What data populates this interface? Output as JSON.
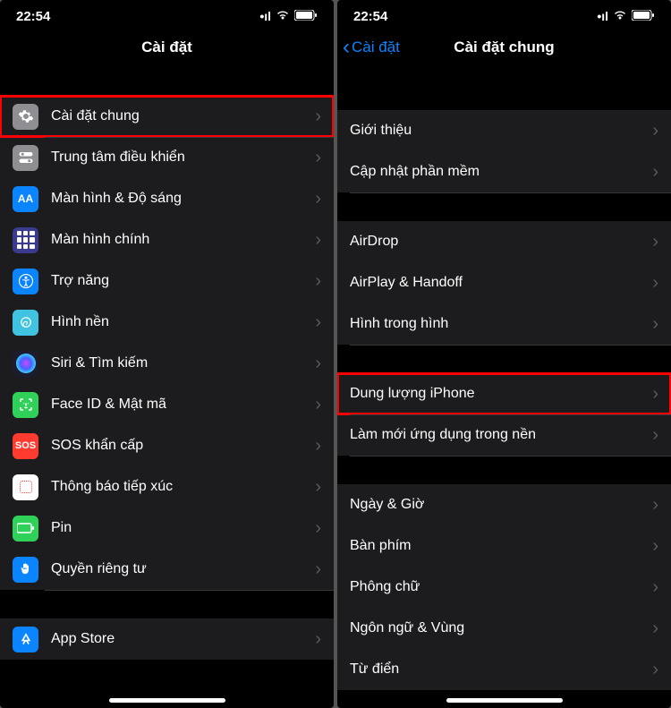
{
  "status": {
    "time": "22:54"
  },
  "left": {
    "title": "Cài đặt",
    "group1": [
      {
        "label": "Cài đặt chung",
        "icon": "gear",
        "highlight": true
      },
      {
        "label": "Trung tâm điều khiển",
        "icon": "control"
      },
      {
        "label": "Màn hình & Độ sáng",
        "icon": "display"
      },
      {
        "label": "Màn hình chính",
        "icon": "home"
      },
      {
        "label": "Trợ năng",
        "icon": "access"
      },
      {
        "label": "Hình nền",
        "icon": "wallpaper"
      },
      {
        "label": "Siri & Tìm kiếm",
        "icon": "siri"
      },
      {
        "label": "Face ID & Mật mã",
        "icon": "faceid"
      },
      {
        "label": "SOS khẩn cấp",
        "icon": "sos"
      },
      {
        "label": "Thông báo tiếp xúc",
        "icon": "exposure"
      },
      {
        "label": "Pin",
        "icon": "battery"
      },
      {
        "label": "Quyền riêng tư",
        "icon": "privacy"
      }
    ],
    "group2": [
      {
        "label": "App Store",
        "icon": "appstore"
      }
    ]
  },
  "right": {
    "back": "Cài đặt",
    "title": "Cài đặt chung",
    "groups": [
      [
        {
          "label": "Giới thiệu"
        },
        {
          "label": "Cập nhật phần mềm"
        }
      ],
      [
        {
          "label": "AirDrop"
        },
        {
          "label": "AirPlay & Handoff"
        },
        {
          "label": "Hình trong hình"
        }
      ],
      [
        {
          "label": "Dung lượng iPhone",
          "highlight": true
        },
        {
          "label": "Làm mới ứng dụng trong nền"
        }
      ],
      [
        {
          "label": "Ngày & Giờ"
        },
        {
          "label": "Bàn phím"
        },
        {
          "label": "Phông chữ"
        },
        {
          "label": "Ngôn ngữ & Vùng"
        },
        {
          "label": "Từ điển"
        }
      ]
    ]
  }
}
